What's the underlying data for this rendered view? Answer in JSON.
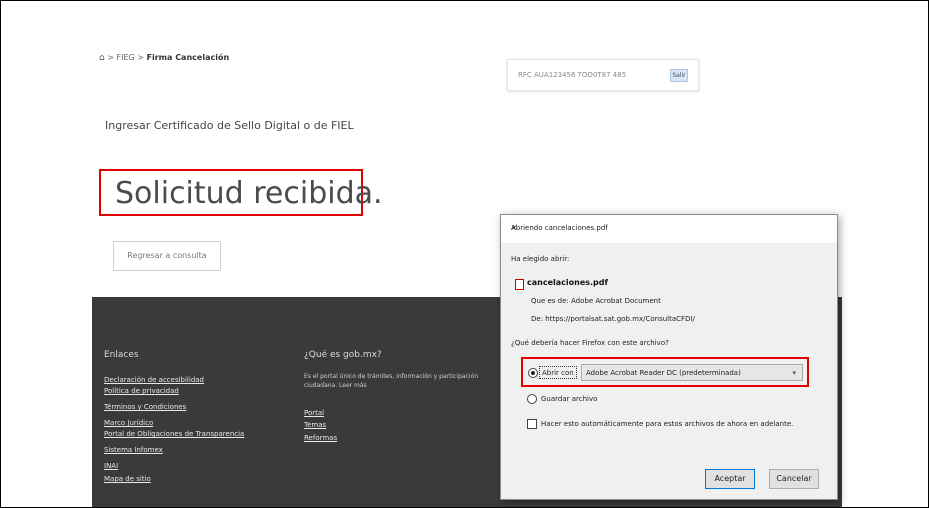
{
  "breadcrumb": {
    "home_icon": "⌂",
    "middle": " > FIEG > ",
    "current": "Firma Cancelación"
  },
  "rfc": {
    "text": "RFC AUA123456 TOO0T87 485",
    "button": "Salir"
  },
  "page": {
    "subtitle": "Ingresar Certificado de Sello Digital o de FIEL",
    "title": "Solicitud recibida.",
    "query_button": "Regresar a consulta"
  },
  "footer": {
    "col1_title": "Enlaces",
    "col1_links": [
      "Declaración de accesibilidad",
      "Política de privacidad",
      "Términos y Condiciones",
      "Marco Jurídico",
      "Portal de Obligaciones de Transparencia",
      "Sistema Infomex",
      "INAI",
      "Mapa de sitio"
    ],
    "col2_title": "¿Qué es gob.mx?",
    "col2_desc": "Es el portal único de trámites, información y participación ciudadana. Leer más",
    "col2_links": [
      "Portal",
      "Temas",
      "Reformas"
    ]
  },
  "dialog": {
    "title": "Abriendo cancelaciones.pdf",
    "intro": "Ha elegido abrir:",
    "filename": "cancelaciones.pdf",
    "type_line": "Que es de: Adobe Acrobat Document",
    "from_line": "De: https://portalsat.sat.gob.mx/ConsultaCFDI/",
    "question": "¿Qué debería hacer Firefox con este archivo?",
    "open_with_label": "Abrir con",
    "app_option": "Adobe Acrobat Reader DC (predeterminada)",
    "save_label": "Guardar archivo",
    "remember_label": "Hacer esto automáticamente para estos archivos de ahora en adelante.",
    "accept_button": "Aceptar",
    "cancel_button": "Cancelar"
  }
}
